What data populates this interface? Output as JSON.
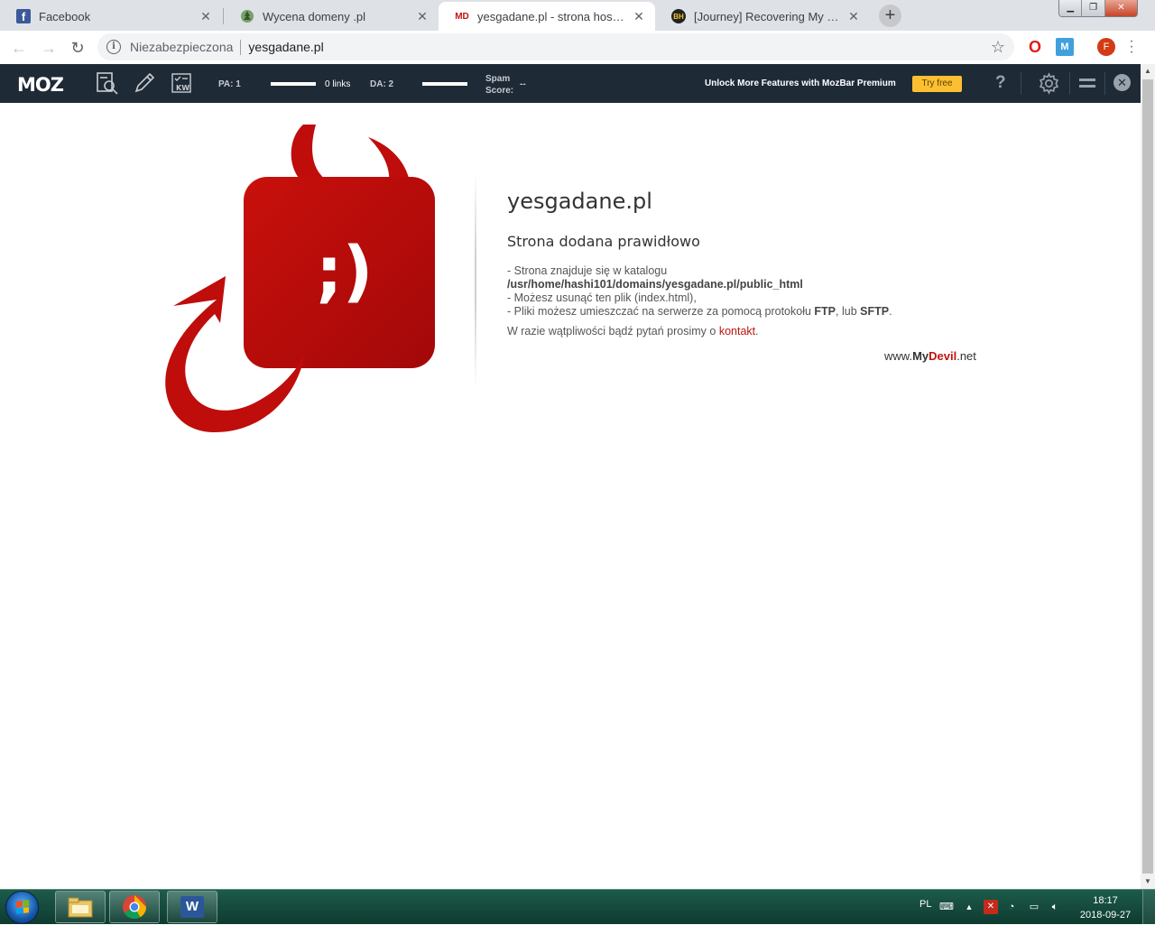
{
  "tabs": [
    {
      "title": "Facebook",
      "favicon": "facebook-icon"
    },
    {
      "title": "Wycena domeny .pl",
      "favicon": "tree-globe-icon"
    },
    {
      "title": "yesgadane.pl - strona hostowana",
      "favicon_text": "MD",
      "active": true
    },
    {
      "title": "[Journey] Recovering My PENALI",
      "favicon": "bh-icon"
    }
  ],
  "omnibox": {
    "security_label": "Niezabezpieczona",
    "url": "yesgadane.pl"
  },
  "extensions": {
    "profile_initial": "F",
    "moz_ext_letter": "M"
  },
  "mozbar": {
    "logo": "MOZ",
    "pa": "PA: 1",
    "links": "0 links",
    "da": "DA: 2",
    "spam_label_line1": "Spam",
    "spam_label_line2": "Score:",
    "spam_value": "--",
    "unlock_text": "Unlock More Features with MozBar Premium",
    "try_free": "Try free",
    "help": "?",
    "accent_color": "#fcbf32",
    "bar_color": "#1f2a37"
  },
  "page": {
    "logo_face": ";)",
    "title": "yesgadane.pl",
    "subtitle": "Strona dodana prawidłowo",
    "line1_prefix": "- Strona znajduje się w katalogu",
    "path": "/usr/home/hashi101/domains/yesgadane.pl/public_html",
    "line2": "- Możesz usunąć ten plik (index.html),",
    "line3_prefix": "- Pliki możesz umieszczać na serwerze za pomocą protokołu ",
    "ftp": "FTP",
    "line3_mid": ", lub ",
    "sftp": "SFTP",
    "line3_end": ".",
    "contact_prefix": "W razie wątpliwości bądź pytań prosimy o ",
    "contact_link": "kontakt",
    "contact_end": ".",
    "brand_prefix": "www.",
    "brand_my": "My",
    "brand_devil": "Devil",
    "brand_suffix": ".net",
    "brand_color": "#c0140f"
  },
  "taskbar": {
    "language": "PL",
    "time": "18:17",
    "date": "2018-09-27",
    "word_letter": "W"
  }
}
